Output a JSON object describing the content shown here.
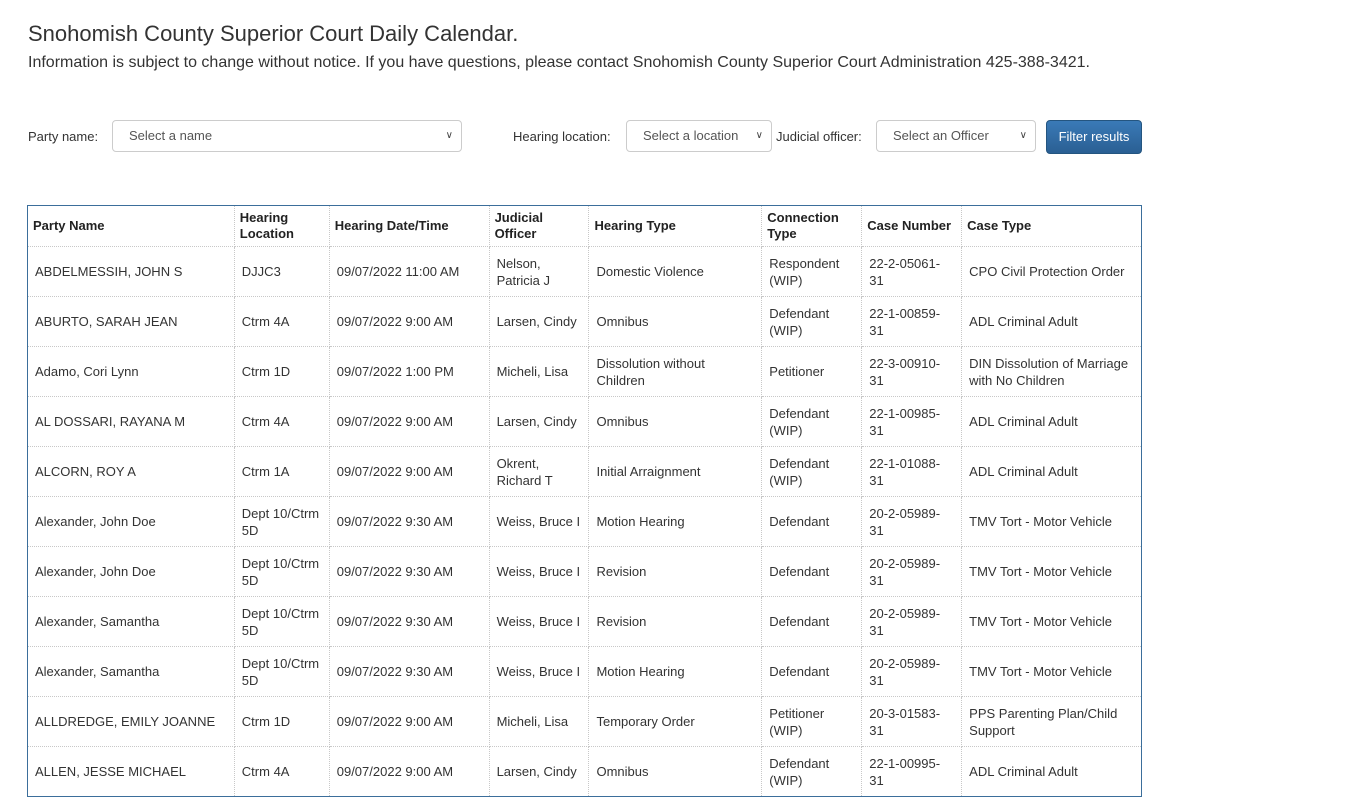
{
  "header": {
    "title": "Snohomish County Superior Court Daily Calendar.",
    "subtitle": "Information is subject to change without notice. If you have questions, please contact Snohomish County Superior Court Administration 425-388-3421."
  },
  "filters": {
    "party_label": "Party name:",
    "party_value": "Select a name",
    "location_label": "Hearing location:",
    "location_value": "Select a location",
    "officer_label": "Judicial officer:",
    "officer_value": "Select an Officer",
    "filter_button": "Filter results",
    "chevron_icon": "chevron-down-icon"
  },
  "table": {
    "columns": [
      "Party Name",
      "Hearing Location",
      "Hearing Date/Time",
      "Judicial Officer",
      "Hearing Type",
      "Connection Type",
      "Case Number",
      "Case Type"
    ],
    "rows": [
      [
        "ABDELMESSIH, JOHN S",
        "DJJC3",
        "09/07/2022 11:00 AM",
        "Nelson, Patricia J",
        "Domestic Violence",
        "Respondent (WIP)",
        "22-2-05061-31",
        "CPO Civil Protection Order"
      ],
      [
        "ABURTO, SARAH JEAN",
        "Ctrm 4A",
        "09/07/2022 9:00 AM",
        "Larsen, Cindy",
        "Omnibus",
        "Defendant (WIP)",
        "22-1-00859-31",
        "ADL Criminal Adult"
      ],
      [
        "Adamo, Cori Lynn",
        "Ctrm 1D",
        "09/07/2022 1:00 PM",
        "Micheli, Lisa",
        "Dissolution without Children",
        "Petitioner",
        "22-3-00910-31",
        "DIN Dissolution of Marriage with No Children"
      ],
      [
        "AL DOSSARI, RAYANA M",
        "Ctrm 4A",
        "09/07/2022 9:00 AM",
        "Larsen, Cindy",
        "Omnibus",
        "Defendant (WIP)",
        "22-1-00985-31",
        "ADL Criminal Adult"
      ],
      [
        "ALCORN, ROY A",
        "Ctrm 1A",
        "09/07/2022 9:00 AM",
        "Okrent, Richard T",
        "Initial Arraignment",
        "Defendant (WIP)",
        "22-1-01088-31",
        "ADL Criminal Adult"
      ],
      [
        "Alexander, John Doe",
        "Dept 10/Ctrm 5D",
        "09/07/2022 9:30 AM",
        "Weiss, Bruce I",
        "Motion Hearing",
        "Defendant",
        "20-2-05989-31",
        "TMV Tort - Motor Vehicle"
      ],
      [
        "Alexander, John Doe",
        "Dept 10/Ctrm 5D",
        "09/07/2022 9:30 AM",
        "Weiss, Bruce I",
        "Revision",
        "Defendant",
        "20-2-05989-31",
        "TMV Tort - Motor Vehicle"
      ],
      [
        "Alexander, Samantha",
        "Dept 10/Ctrm 5D",
        "09/07/2022 9:30 AM",
        "Weiss, Bruce I",
        "Revision",
        "Defendant",
        "20-2-05989-31",
        "TMV Tort - Motor Vehicle"
      ],
      [
        "Alexander, Samantha",
        "Dept 10/Ctrm 5D",
        "09/07/2022 9:30 AM",
        "Weiss, Bruce I",
        "Motion Hearing",
        "Defendant",
        "20-2-05989-31",
        "TMV Tort - Motor Vehicle"
      ],
      [
        "ALLDREDGE, EMILY JOANNE",
        "Ctrm 1D",
        "09/07/2022 9:00 AM",
        "Micheli, Lisa",
        "Temporary Order",
        "Petitioner (WIP)",
        "20-3-01583-31",
        "PPS Parenting Plan/Child Support"
      ],
      [
        "ALLEN, JESSE MICHAEL",
        "Ctrm 4A",
        "09/07/2022 9:00 AM",
        "Larsen, Cindy",
        "Omnibus",
        "Defendant (WIP)",
        "22-1-00995-31",
        "ADL Criminal Adult"
      ]
    ]
  },
  "colors": {
    "accent": "#2f6da3",
    "table_border": "#3b6e9b"
  }
}
